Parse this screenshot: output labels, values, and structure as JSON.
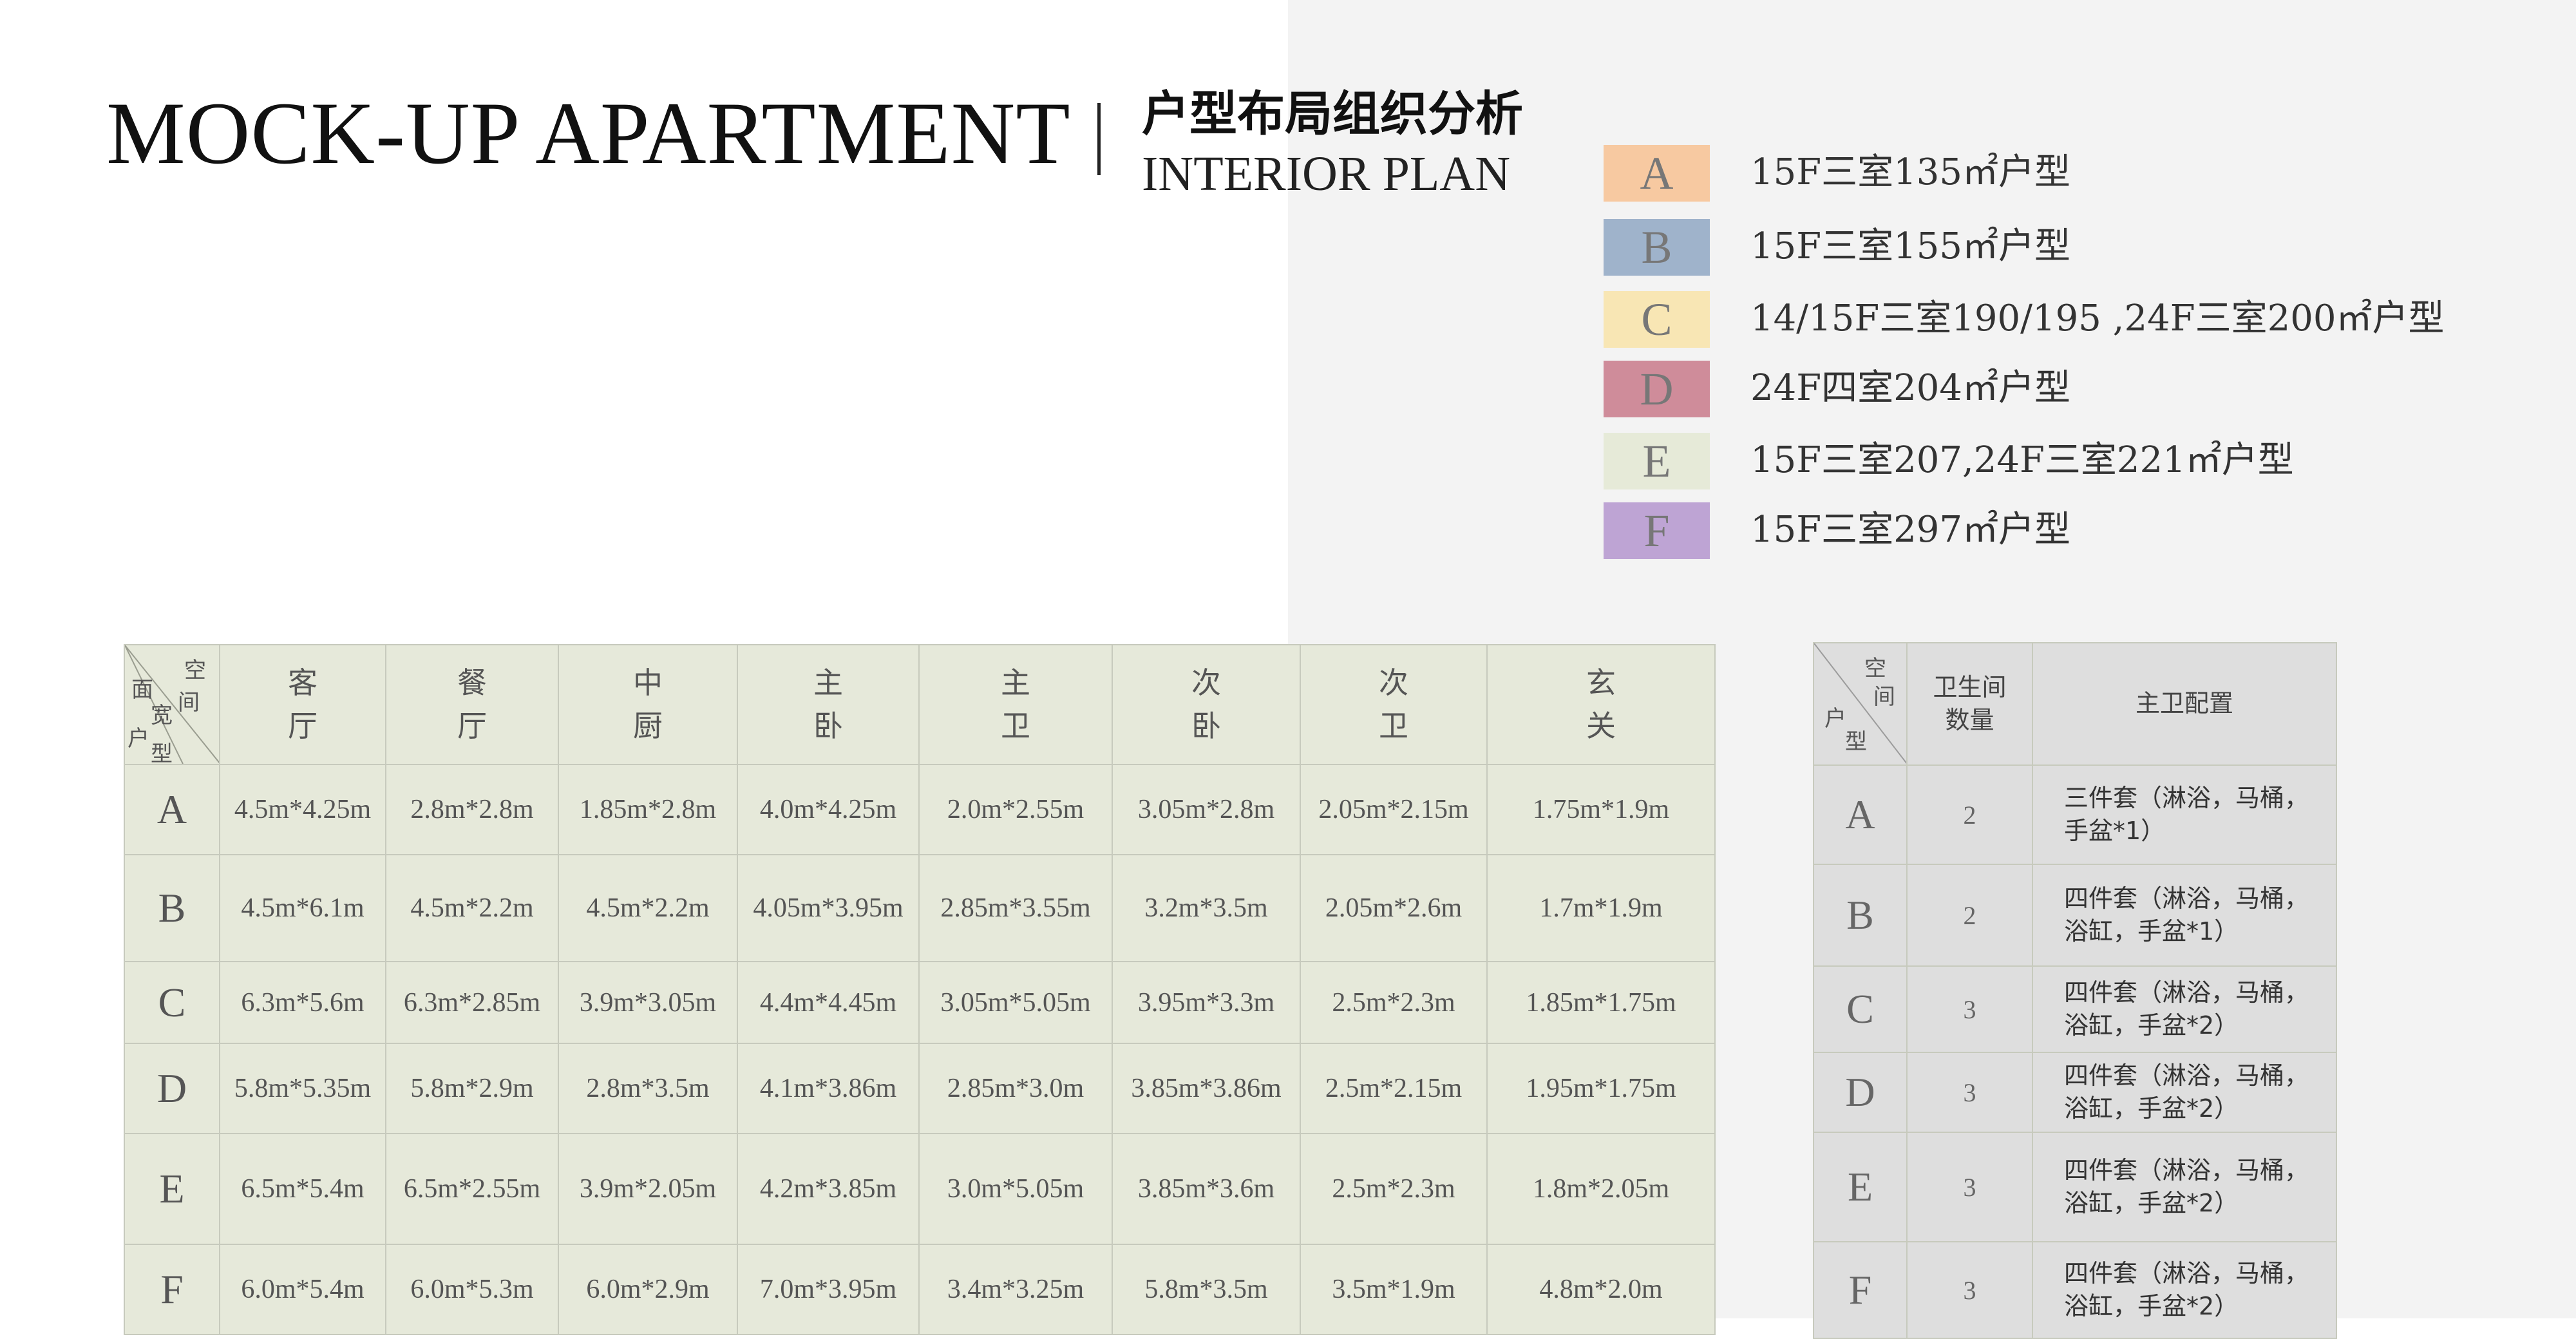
{
  "header": {
    "title": "MOCK-UP APARTMENT",
    "cn_title": "户型布局组织分析",
    "subtitle": "INTERIOR PLAN"
  },
  "colors": {
    "A": "#f7c9a1",
    "B": "#9fb3cb",
    "C": "#f8e6b4",
    "D": "#cf8c9a",
    "E": "#e6ead8",
    "F": "#bea4d4"
  },
  "legend": [
    {
      "letter": "A",
      "text": "15F三室135㎡户型"
    },
    {
      "letter": "B",
      "text": "15F三室155㎡户型"
    },
    {
      "letter": "C",
      "text": "14/15F三室190/195 ,24F三室200㎡户型"
    },
    {
      "letter": "D",
      "text": "24F四室204㎡户型"
    },
    {
      "letter": "E",
      "text": "15F三室207,24F三室221㎡户型"
    },
    {
      "letter": "F",
      "text": "15F三室297㎡户型"
    }
  ],
  "room_table": {
    "corner": {
      "top": "空",
      "mid": "间",
      "c1": "面",
      "c2": "宽",
      "c3": "户",
      "c4": "型"
    },
    "headers": [
      [
        "客",
        "厅"
      ],
      [
        "餐",
        "厅"
      ],
      [
        "中",
        "厨"
      ],
      [
        "主",
        "卧"
      ],
      [
        "主",
        "卫"
      ],
      [
        "次",
        "卧"
      ],
      [
        "次",
        "卫"
      ],
      [
        "玄",
        "关"
      ]
    ],
    "rows": [
      {
        "type": "A",
        "cells": [
          "4.5m*4.25m",
          "2.8m*2.8m",
          "1.85m*2.8m",
          "4.0m*4.25m",
          "2.0m*2.55m",
          "3.05m*2.8m",
          "2.05m*2.15m",
          "1.75m*1.9m"
        ]
      },
      {
        "type": "B",
        "cells": [
          "4.5m*6.1m",
          "4.5m*2.2m",
          "4.5m*2.2m",
          "4.05m*3.95m",
          "2.85m*3.55m",
          "3.2m*3.5m",
          "2.05m*2.6m",
          "1.7m*1.9m"
        ]
      },
      {
        "type": "C",
        "cells": [
          "6.3m*5.6m",
          "6.3m*2.85m",
          "3.9m*3.05m",
          "4.4m*4.45m",
          "3.05m*5.05m",
          "3.95m*3.3m",
          "2.5m*2.3m",
          "1.85m*1.75m"
        ]
      },
      {
        "type": "D",
        "cells": [
          "5.8m*5.35m",
          "5.8m*2.9m",
          "2.8m*3.5m",
          "4.1m*3.86m",
          "2.85m*3.0m",
          "3.85m*3.86m",
          "2.5m*2.15m",
          "1.95m*1.75m"
        ]
      },
      {
        "type": "E",
        "cells": [
          "6.5m*5.4m",
          "6.5m*2.55m",
          "3.9m*2.05m",
          "4.2m*3.85m",
          "3.0m*5.05m",
          "3.85m*3.6m",
          "2.5m*2.3m",
          "1.8m*2.05m"
        ]
      },
      {
        "type": "F",
        "cells": [
          "6.0m*5.4m",
          "6.0m*5.3m",
          "6.0m*2.9m",
          "7.0m*3.95m",
          "3.4m*3.25m",
          "5.8m*3.5m",
          "3.5m*1.9m",
          "4.8m*2.0m"
        ]
      }
    ]
  },
  "bath_table": {
    "corner": {
      "top": "空",
      "mid": "间",
      "c1": "户",
      "c2": "型"
    },
    "header_count": [
      "卫生间",
      "数量"
    ],
    "header_config": "主卫配置",
    "rows": [
      {
        "type": "A",
        "count": "2",
        "config": [
          "三件套（淋浴，马桶，",
          "手盆*1）"
        ]
      },
      {
        "type": "B",
        "count": "2",
        "config": [
          "四件套（淋浴，马桶，",
          "浴缸，手盆*1）"
        ]
      },
      {
        "type": "C",
        "count": "3",
        "config": [
          "四件套（淋浴，马桶，",
          "浴缸，手盆*2）"
        ]
      },
      {
        "type": "D",
        "count": "3",
        "config": [
          "四件套（淋浴，马桶，",
          "浴缸，手盆*2）"
        ]
      },
      {
        "type": "E",
        "count": "3",
        "config": [
          "四件套（淋浴，马桶，",
          "浴缸，手盆*2）"
        ]
      },
      {
        "type": "F",
        "count": "3",
        "config": [
          "四件套（淋浴，马桶，",
          "浴缸，手盆*2）"
        ]
      }
    ]
  }
}
